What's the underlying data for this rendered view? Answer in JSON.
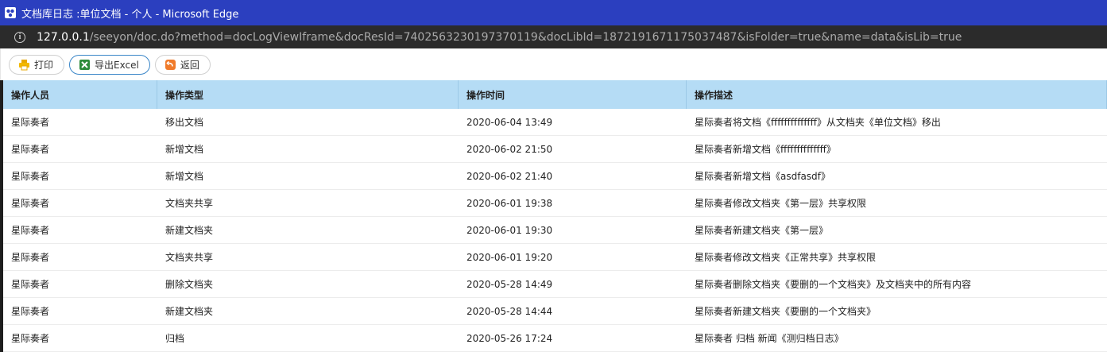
{
  "window": {
    "title": "文档库日志 :单位文档 - 个人 - Microsoft Edge"
  },
  "address": {
    "host": "127.0.0.1",
    "path": "/seeyon/doc.do?method=docLogViewIframe&docResId=7402563230197370119&docLibId=1872191671175037487&isFolder=true&name=data&isLib=true"
  },
  "toolbar": {
    "print_label": "打印",
    "export_label": "导出Excel",
    "back_label": "返回"
  },
  "table": {
    "headers": [
      "操作人员",
      "操作类型",
      "操作时间",
      "操作描述"
    ],
    "rows": [
      [
        "星际奏者",
        "移出文档",
        "2020-06-04 13:49",
        "星际奏者将文档《ffffffffffffff》从文档夹《单位文档》移出"
      ],
      [
        "星际奏者",
        "新增文档",
        "2020-06-02 21:50",
        "星际奏者新增文档《ffffffffffffff》"
      ],
      [
        "星际奏者",
        "新增文档",
        "2020-06-02 21:40",
        "星际奏者新增文档《asdfasdf》"
      ],
      [
        "星际奏者",
        "文档夹共享",
        "2020-06-01 19:38",
        "星际奏者修改文档夹《第一层》共享权限"
      ],
      [
        "星际奏者",
        "新建文档夹",
        "2020-06-01 19:30",
        "星际奏者新建文档夹《第一层》"
      ],
      [
        "星际奏者",
        "文档夹共享",
        "2020-06-01 19:20",
        "星际奏者修改文档夹《正常共享》共享权限"
      ],
      [
        "星际奏者",
        "删除文档夹",
        "2020-05-28 14:49",
        "星际奏者删除文档夹《要删的一个文档夹》及文档夹中的所有内容"
      ],
      [
        "星际奏者",
        "新建文档夹",
        "2020-05-28 14:44",
        "星际奏者新建文档夹《要删的一个文档夹》"
      ],
      [
        "星际奏者",
        "归档",
        "2020-05-26 17:24",
        "星际奏者 归档 新闻《测归档日志》"
      ]
    ]
  },
  "icons": {
    "print": "printer-icon",
    "export": "excel-icon",
    "back": "back-arrow-icon"
  },
  "colors": {
    "titlebar": "#2b3fbf",
    "header": "#b5dcf5",
    "active_border": "#3a86c8"
  }
}
